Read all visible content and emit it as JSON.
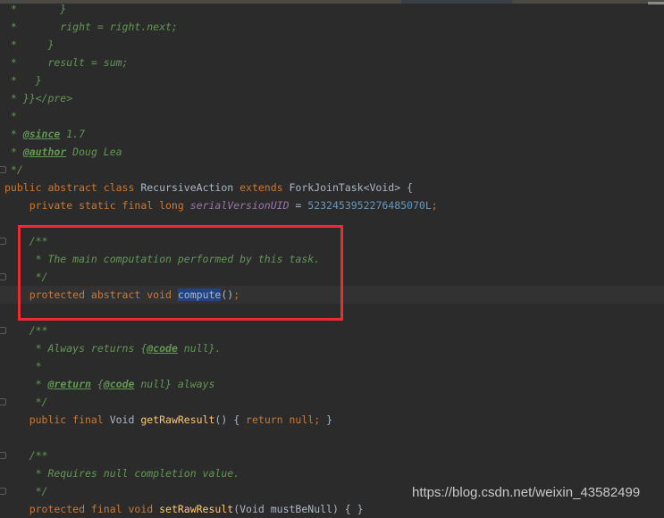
{
  "editor": {
    "highlighted_line": 16,
    "fold_lines": [
      9,
      13,
      15,
      18,
      22,
      25,
      27
    ],
    "lines": [
      [
        [
          " *       }",
          "cm"
        ]
      ],
      [
        [
          " *       right = right.next;",
          "cm"
        ]
      ],
      [
        [
          " *     }",
          "cm"
        ]
      ],
      [
        [
          " *     result = sum;",
          "cm"
        ]
      ],
      [
        [
          " *   }",
          "cm"
        ]
      ],
      [
        [
          " * }}</pre>",
          "cm"
        ]
      ],
      [
        [
          " *",
          "cm"
        ]
      ],
      [
        [
          " * ",
          "cm"
        ],
        [
          "@since",
          "tag"
        ],
        [
          " 1.7",
          "cm"
        ]
      ],
      [
        [
          " * ",
          "cm"
        ],
        [
          "@author",
          "tag"
        ],
        [
          " Doug Lea",
          "cm"
        ]
      ],
      [
        [
          " */",
          "cm"
        ]
      ],
      [
        [
          "public abstract class ",
          "kw"
        ],
        [
          "RecursiveAction ",
          "id"
        ],
        [
          "extends ",
          "kw"
        ],
        [
          "ForkJoinTask<Void> {",
          "id"
        ]
      ],
      [
        [
          "    private static final long ",
          "kw"
        ],
        [
          "serialVersionUID",
          "field"
        ],
        [
          " = ",
          "id"
        ],
        [
          "5232453952276485070L",
          "num"
        ],
        [
          ";",
          "kw"
        ]
      ],
      [],
      [
        [
          "    /**",
          "cm"
        ]
      ],
      [
        [
          "     * The main computation performed by this task.",
          "cm"
        ]
      ],
      [
        [
          "     */",
          "cm"
        ]
      ],
      [
        [
          "    protected abstract void ",
          "kw"
        ],
        [
          "compute",
          "sel"
        ],
        [
          "()",
          "id"
        ],
        [
          ";",
          "kw"
        ]
      ],
      [],
      [
        [
          "    /**",
          "cm"
        ]
      ],
      [
        [
          "     * Always returns {",
          "cm"
        ],
        [
          "@code",
          "tag"
        ],
        [
          " null}.",
          "cm"
        ]
      ],
      [
        [
          "     *",
          "cm"
        ]
      ],
      [
        [
          "     * ",
          "cm"
        ],
        [
          "@return",
          "tag"
        ],
        [
          " {",
          "cm"
        ],
        [
          "@code",
          "tag"
        ],
        [
          " null} always",
          "cm"
        ]
      ],
      [
        [
          "     */",
          "cm"
        ]
      ],
      [
        [
          "    public final ",
          "kw"
        ],
        [
          "Void ",
          "id"
        ],
        [
          "getRawResult",
          "method"
        ],
        [
          "() { ",
          "id"
        ],
        [
          "return null",
          "kw"
        ],
        [
          "; ",
          "kw"
        ],
        [
          "}",
          "id"
        ]
      ],
      [],
      [
        [
          "    /**",
          "cm"
        ]
      ],
      [
        [
          "     * Requires null completion value.",
          "cm"
        ]
      ],
      [
        [
          "     */",
          "cm"
        ]
      ],
      [
        [
          "    protected final void ",
          "kw"
        ],
        [
          "setRawResult",
          "method"
        ],
        [
          "(Void mustBeNull) { }",
          "id"
        ]
      ]
    ]
  },
  "annotation": {
    "box_color": "#ee2a35"
  },
  "watermark": "https://blog.csdn.net/weixin_43582499",
  "colors": {
    "background": "#2b2b2b",
    "keyword": "#cc7832",
    "comment": "#629755",
    "number": "#6897bb",
    "field": "#9876aa",
    "method": "#ffc66d",
    "selection": "#214283"
  }
}
